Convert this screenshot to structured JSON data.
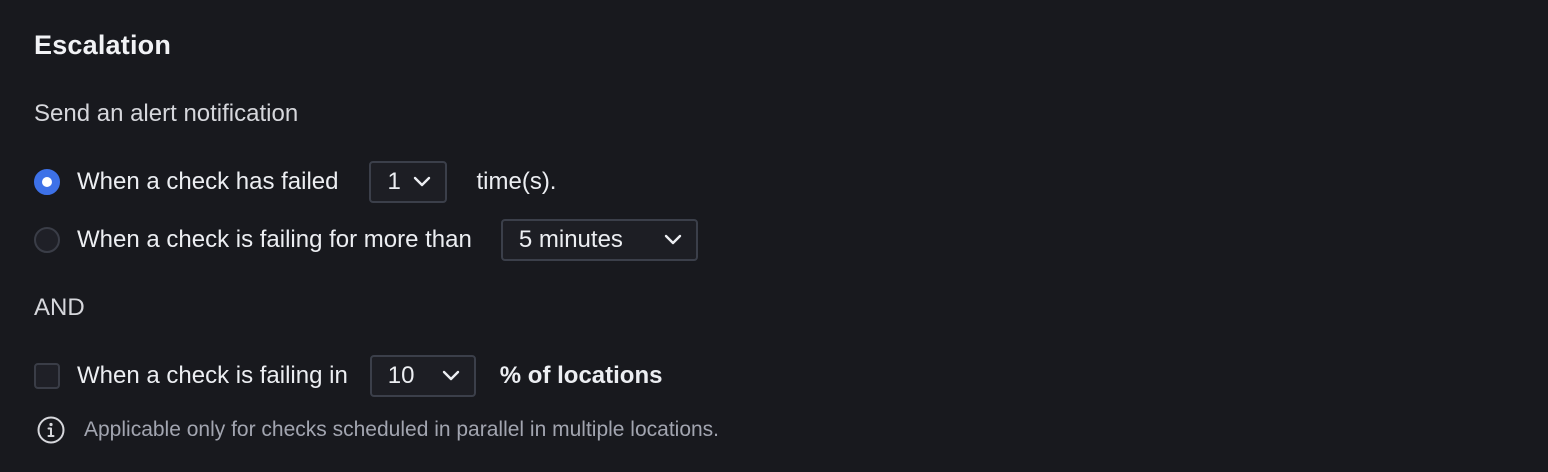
{
  "section": {
    "title": "Escalation",
    "subtitle": "Send an alert notification"
  },
  "options": {
    "failed_count": {
      "label": "When a check has failed",
      "selected": true,
      "select_value": "1",
      "suffix": "time(s)."
    },
    "failing_duration": {
      "label": "When a check is failing for more than",
      "selected": false,
      "select_value": "5 minutes"
    }
  },
  "and_label": "AND",
  "locations": {
    "label": "When a check is failing in",
    "checked": false,
    "select_value": "10",
    "suffix": "% of locations"
  },
  "hint": {
    "icon": "info-icon",
    "text": "Applicable only for checks scheduled in parallel in multiple locations."
  },
  "colors": {
    "background": "#18191e",
    "accent": "#3d71e8"
  }
}
